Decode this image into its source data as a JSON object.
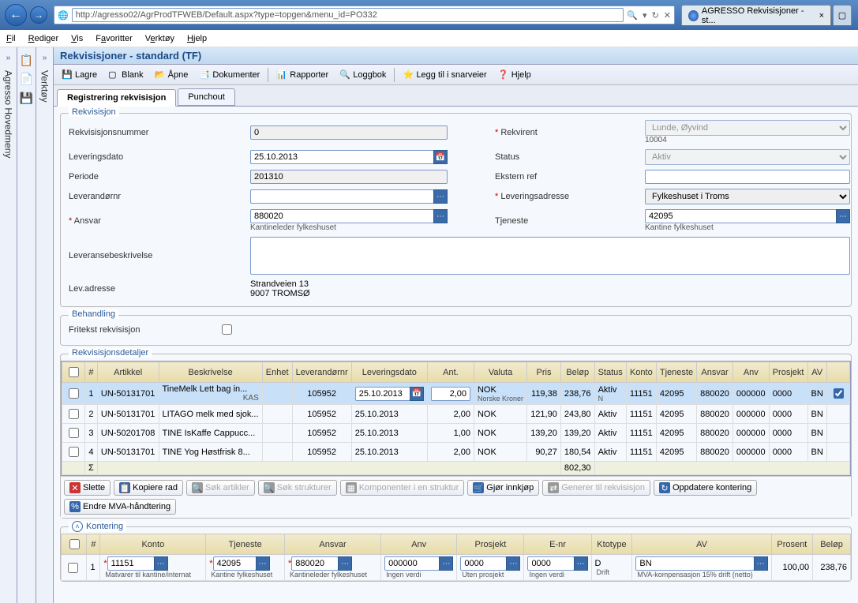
{
  "browser": {
    "url": "http://agresso02/AgrProdTFWEB/Default.aspx?type=topgen&menu_id=PO332",
    "tab_title": "AGRESSO Rekvisisjoner - st...",
    "tab_close": "×"
  },
  "menubar": {
    "fil": "Fil",
    "rediger": "Rediger",
    "vis": "Vis",
    "favoritter": "Favoritter",
    "verktoy": "Verktøy",
    "hjelp": "Hjelp"
  },
  "side": {
    "hovedmeny": "Agresso Hovedmeny",
    "verktoy": "Verktøy"
  },
  "page_title": "Rekvisisjoner - standard (TF)",
  "toolbar": {
    "lagre": "Lagre",
    "blank": "Blank",
    "apne": "Åpne",
    "dok": "Dokumenter",
    "rapp": "Rapporter",
    "logg": "Loggbok",
    "snarv": "Legg til i snarveier",
    "hjelp": "Hjelp"
  },
  "tabs": {
    "reg": "Registrering rekvisisjon",
    "punch": "Punchout"
  },
  "rekvisisjon": {
    "legend": "Rekvisisjon",
    "labels": {
      "nr": "Rekvisisjonsnummer",
      "dato": "Leveringsdato",
      "periode": "Periode",
      "lev": "Leverandørnr",
      "ansvar": "Ansvar",
      "besk": "Leveransebeskrivelse",
      "adresse": "Lev.adresse",
      "rekvirent": "Rekvirent",
      "status": "Status",
      "ekstern": "Ekstern ref",
      "levadr": "Leveringsadresse",
      "tjeneste": "Tjeneste"
    },
    "values": {
      "nr": "0",
      "dato": "25.10.2013",
      "periode": "201310",
      "lev": "",
      "ansvar": "880020",
      "ansvar_desc": "Kantineleder fylkeshuset",
      "besk": "",
      "adresse": "Strandveien 13\n9007 TROMSØ",
      "rekvirent": "Lunde, Øyvind",
      "rekvirent_id": "10004",
      "status": "Aktiv",
      "ekstern": "",
      "levadr": "Fylkeshuset i Troms",
      "tjeneste": "42095",
      "tjeneste_desc": "Kantine fylkeshuset"
    }
  },
  "behandling": {
    "legend": "Behandling",
    "fritekst_label": "Fritekst rekvisisjon"
  },
  "detaljer": {
    "legend": "Rekvisisjonsdetaljer",
    "headers": {
      "num": "#",
      "art": "Artikkel",
      "besk": "Beskrivelse",
      "enhet": "Enhet",
      "lev": "Leverandørnr",
      "dato": "Leveringsdato",
      "ant": "Ant.",
      "val": "Valuta",
      "pris": "Pris",
      "belop": "Beløp",
      "status": "Status",
      "konto": "Konto",
      "tjen": "Tjeneste",
      "ansv": "Ansvar",
      "anv": "Anv",
      "prosj": "Prosjekt",
      "av": "AV"
    },
    "rows": [
      {
        "n": "1",
        "art": "UN-50131701",
        "besk": "TineMelk Lett bag in...",
        "enhet": "KAS",
        "lev": "105952",
        "dato": "25.10.2013",
        "ant": "2,00",
        "val": "NOK",
        "valdesc": "Norske Kroner",
        "pris": "119,38",
        "belop": "238,76",
        "status": "Aktiv",
        "statusdesc": "N",
        "konto": "11151",
        "tjen": "42095",
        "ansv": "880020",
        "anv": "000000",
        "prosj": "0000",
        "av": "BN"
      },
      {
        "n": "2",
        "art": "UN-50131701",
        "besk": "LITAGO melk med sjok...",
        "enhet": "",
        "lev": "105952",
        "dato": "25.10.2013",
        "ant": "2,00",
        "val": "NOK",
        "pris": "121,90",
        "belop": "243,80",
        "status": "Aktiv",
        "konto": "11151",
        "tjen": "42095",
        "ansv": "880020",
        "anv": "000000",
        "prosj": "0000",
        "av": "BN"
      },
      {
        "n": "3",
        "art": "UN-50201708",
        "besk": "TINE IsKaffe Cappucc...",
        "enhet": "",
        "lev": "105952",
        "dato": "25.10.2013",
        "ant": "1,00",
        "val": "NOK",
        "pris": "139,20",
        "belop": "139,20",
        "status": "Aktiv",
        "konto": "11151",
        "tjen": "42095",
        "ansv": "880020",
        "anv": "000000",
        "prosj": "0000",
        "av": "BN"
      },
      {
        "n": "4",
        "art": "UN-50131701",
        "besk": "TINE Yog Høstfrisk 8...",
        "enhet": "",
        "lev": "105952",
        "dato": "25.10.2013",
        "ant": "2,00",
        "val": "NOK",
        "pris": "90,27",
        "belop": "180,54",
        "status": "Aktiv",
        "konto": "11151",
        "tjen": "42095",
        "ansv": "880020",
        "anv": "000000",
        "prosj": "0000",
        "av": "BN"
      }
    ],
    "sum_label": "Σ",
    "sum_belop": "802,30"
  },
  "actions": {
    "slette": "Slette",
    "kopier": "Kopiere rad",
    "sokart": "Søk artikler",
    "sokstr": "Søk strukturer",
    "komp": "Komponenter i en struktur",
    "innkjop": "Gjør innkjøp",
    "gener": "Generer til rekvisisjon",
    "oppd": "Oppdatere kontering",
    "mva": "Endre MVA-håndtering"
  },
  "kontering": {
    "legend": "Kontering",
    "headers": {
      "num": "#",
      "konto": "Konto",
      "tjen": "Tjeneste",
      "ansv": "Ansvar",
      "anv": "Anv",
      "prosj": "Prosjekt",
      "enr": "E-nr",
      "kto": "Ktotype",
      "av": "AV",
      "pros": "Prosent",
      "belop": "Beløp"
    },
    "row": {
      "n": "1",
      "konto": "11151",
      "konto_desc": "Matvarer til kantine/internat",
      "tjen": "42095",
      "tjen_desc": "Kantine fylkeshuset",
      "ansv": "880020",
      "ansv_desc": "Kantineleder fylkeshuset",
      "anv": "000000",
      "anv_desc": "Ingen verdi",
      "prosj": "0000",
      "prosj_desc": "Uten prosjekt",
      "enr": "0000",
      "enr_desc": "Ingen verdi",
      "kto": "D",
      "kto_desc": "Drift",
      "av": "BN",
      "av_desc": "MVA-kompensasjon 15% drift (netto)",
      "pros": "100,00",
      "belop": "238,76"
    }
  }
}
